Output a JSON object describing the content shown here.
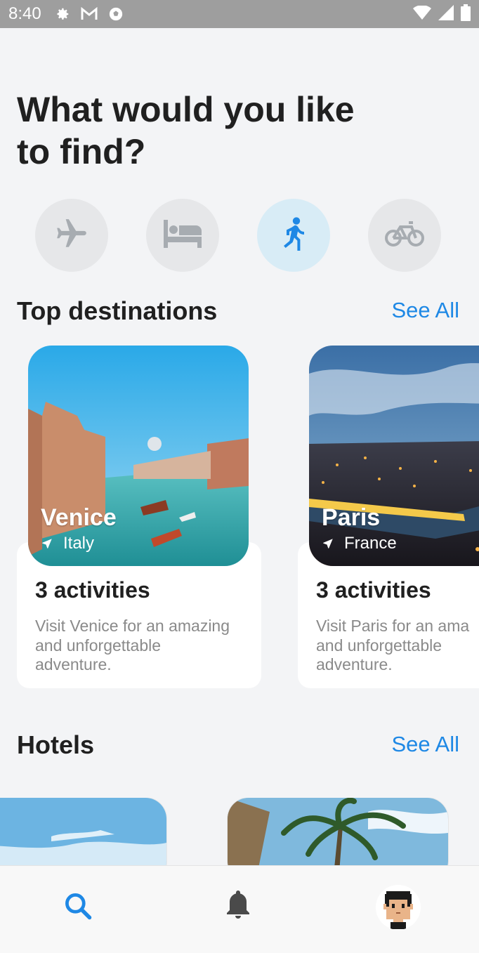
{
  "status_bar": {
    "time": "8:40",
    "icons": [
      "settings-icon",
      "gmail-icon",
      "soccer-ball-icon",
      "wifi-icon",
      "signal-icon",
      "battery-icon"
    ]
  },
  "page_title": "What would you like to find?",
  "categories": [
    {
      "name": "flights",
      "icon": "airplane-icon",
      "active": false
    },
    {
      "name": "hotels",
      "icon": "bed-icon",
      "active": false
    },
    {
      "name": "activities",
      "icon": "walking-person-icon",
      "active": true
    },
    {
      "name": "bikes",
      "icon": "bicycle-icon",
      "active": false
    }
  ],
  "colors": {
    "accent": "#1e88e5",
    "active_category_bg": "#d8ecf6",
    "inactive_category_bg": "#e6e7e9",
    "inactive_icon": "#a7acb1"
  },
  "top_destinations": {
    "title": "Top destinations",
    "see_all": "See All",
    "items": [
      {
        "city": "Venice",
        "country": "Italy",
        "activities": "3 activities",
        "desc_line1": "Visit Venice for an amazing",
        "desc_line2": "and unforgettable",
        "desc_line3": "adventure."
      },
      {
        "city": "Paris",
        "country": "France",
        "activities": "3 activities",
        "desc_line1": "Visit Paris for an ama",
        "desc_line2": "and unforgettable",
        "desc_line3": "adventure."
      }
    ]
  },
  "hotels": {
    "title": "Hotels",
    "see_all": "See All"
  },
  "bottom_nav": {
    "items": [
      {
        "name": "search",
        "icon": "search-icon",
        "active": true
      },
      {
        "name": "notifications",
        "icon": "bell-icon",
        "active": false
      },
      {
        "name": "profile",
        "icon": "avatar",
        "active": false
      }
    ]
  }
}
